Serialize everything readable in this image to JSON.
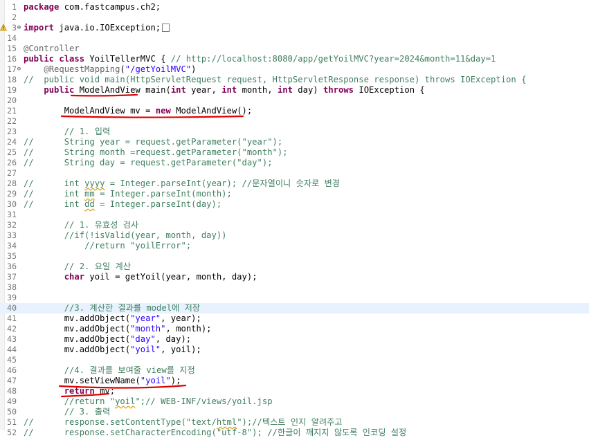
{
  "editor": {
    "lines": [
      {
        "n": "1",
        "seg": [
          {
            "t": "package ",
            "k": "kw"
          },
          {
            "t": "com.fastcampus.ch2;"
          }
        ]
      },
      {
        "n": "2",
        "seg": []
      },
      {
        "n": "3",
        "marker": "⊕",
        "warn": true,
        "seg": [
          {
            "t": "import ",
            "k": "kw"
          },
          {
            "t": "java.io.IOException;"
          },
          {
            "t": "",
            "k": "fold"
          }
        ]
      },
      {
        "n": "14",
        "seg": []
      },
      {
        "n": "15",
        "seg": [
          {
            "t": "@Controller",
            "k": "ann"
          }
        ]
      },
      {
        "n": "16",
        "seg": [
          {
            "t": "public class ",
            "k": "kw"
          },
          {
            "t": "YoilTellerMVC { "
          },
          {
            "t": "// http://localhost:8080/app/getYoilMVC?year=2024&month=11&day=1",
            "k": "cm"
          }
        ]
      },
      {
        "n": "17",
        "marker": "⊖",
        "seg": [
          {
            "t": "    "
          },
          {
            "t": "@RequestMapping",
            "k": "ann"
          },
          {
            "t": "("
          },
          {
            "t": "\"/getYoilMVC\"",
            "k": "str"
          },
          {
            "t": ")"
          }
        ]
      },
      {
        "n": "18",
        "seg": [
          {
            "t": "//  public void main(HttpServletRequest request, HttpServletResponse response) throws IOException {",
            "k": "cm"
          }
        ]
      },
      {
        "n": "19",
        "seg": [
          {
            "t": "    "
          },
          {
            "t": "public ",
            "k": "kw"
          },
          {
            "t": "ModelAndView main("
          },
          {
            "t": "int ",
            "k": "kw"
          },
          {
            "t": "year, "
          },
          {
            "t": "int ",
            "k": "kw"
          },
          {
            "t": "month, "
          },
          {
            "t": "int ",
            "k": "kw"
          },
          {
            "t": "day) "
          },
          {
            "t": "throws ",
            "k": "kw"
          },
          {
            "t": "IOException {"
          }
        ]
      },
      {
        "n": "20",
        "seg": []
      },
      {
        "n": "21",
        "seg": [
          {
            "t": "        ModelAndView mv = "
          },
          {
            "t": "new ",
            "k": "kw"
          },
          {
            "t": "ModelAndView();"
          }
        ]
      },
      {
        "n": "22",
        "seg": []
      },
      {
        "n": "23",
        "seg": [
          {
            "t": "        "
          },
          {
            "t": "// 1. 입력",
            "k": "cm"
          }
        ]
      },
      {
        "n": "24",
        "seg": [
          {
            "t": "//      String year = request.getParameter(\"year\");",
            "k": "cm"
          }
        ]
      },
      {
        "n": "25",
        "seg": [
          {
            "t": "//      String month =request.getParameter(\"month\");",
            "k": "cm"
          }
        ]
      },
      {
        "n": "26",
        "seg": [
          {
            "t": "//      String day = request.getParameter(\"day\");",
            "k": "cm"
          }
        ]
      },
      {
        "n": "27",
        "seg": []
      },
      {
        "n": "28",
        "seg": [
          {
            "t": "//      int ",
            "k": "cm"
          },
          {
            "t": "yyyy",
            "k": "cm sq"
          },
          {
            "t": " = Integer.parseInt(year); //문자열이니 숫자로 변경",
            "k": "cm"
          }
        ]
      },
      {
        "n": "29",
        "seg": [
          {
            "t": "//      int ",
            "k": "cm"
          },
          {
            "t": "mm",
            "k": "cm sq"
          },
          {
            "t": " = Integer.parseInt(month);",
            "k": "cm"
          }
        ]
      },
      {
        "n": "30",
        "seg": [
          {
            "t": "//      int ",
            "k": "cm"
          },
          {
            "t": "dd",
            "k": "cm sq"
          },
          {
            "t": " = Integer.parseInt(day);",
            "k": "cm"
          }
        ]
      },
      {
        "n": "31",
        "seg": []
      },
      {
        "n": "32",
        "seg": [
          {
            "t": "        "
          },
          {
            "t": "// 1. 유효성 검사",
            "k": "cm"
          }
        ]
      },
      {
        "n": "33",
        "seg": [
          {
            "t": "        "
          },
          {
            "t": "//if(!isValid(year, month, day))",
            "k": "cm"
          }
        ]
      },
      {
        "n": "34",
        "seg": [
          {
            "t": "            "
          },
          {
            "t": "//return \"yoilError\";",
            "k": "cm"
          }
        ]
      },
      {
        "n": "35",
        "seg": []
      },
      {
        "n": "36",
        "seg": [
          {
            "t": "        "
          },
          {
            "t": "// 2. 요일 계산",
            "k": "cm"
          }
        ]
      },
      {
        "n": "37",
        "seg": [
          {
            "t": "        "
          },
          {
            "t": "char ",
            "k": "kw"
          },
          {
            "t": "yoil = getYoil(year, month, day);"
          }
        ]
      },
      {
        "n": "38",
        "seg": []
      },
      {
        "n": "39",
        "seg": []
      },
      {
        "n": "40",
        "current": true,
        "seg": [
          {
            "t": "        "
          },
          {
            "t": "//3. 계산한 결과를 model에 저장",
            "k": "cm"
          }
        ]
      },
      {
        "n": "41",
        "seg": [
          {
            "t": "        mv.addObject("
          },
          {
            "t": "\"year\"",
            "k": "str"
          },
          {
            "t": ", year);"
          }
        ]
      },
      {
        "n": "42",
        "seg": [
          {
            "t": "        mv.addObject("
          },
          {
            "t": "\"month\"",
            "k": "str"
          },
          {
            "t": ", month);"
          }
        ]
      },
      {
        "n": "43",
        "seg": [
          {
            "t": "        mv.addObject("
          },
          {
            "t": "\"day\"",
            "k": "str"
          },
          {
            "t": ", day);"
          }
        ]
      },
      {
        "n": "44",
        "seg": [
          {
            "t": "        mv.addObject("
          },
          {
            "t": "\"yoil\"",
            "k": "str"
          },
          {
            "t": ", yoil);"
          }
        ]
      },
      {
        "n": "45",
        "seg": []
      },
      {
        "n": "46",
        "seg": [
          {
            "t": "        "
          },
          {
            "t": "//4. 결과를 보여줄 view를 지정",
            "k": "cm"
          }
        ]
      },
      {
        "n": "47",
        "seg": [
          {
            "t": "        mv.setViewName("
          },
          {
            "t": "\"yoil\"",
            "k": "str"
          },
          {
            "t": ");"
          }
        ]
      },
      {
        "n": "48",
        "seg": [
          {
            "t": "        "
          },
          {
            "t": "return ",
            "k": "kw"
          },
          {
            "t": "mv;"
          }
        ]
      },
      {
        "n": "49",
        "seg": [
          {
            "t": "        "
          },
          {
            "t": "//return \"",
            "k": "cm"
          },
          {
            "t": "yoil",
            "k": "cm sq"
          },
          {
            "t": "\";// WEB-INF/views/yoil.jsp",
            "k": "cm"
          }
        ]
      },
      {
        "n": "50",
        "seg": [
          {
            "t": "        "
          },
          {
            "t": "// 3. 출력",
            "k": "cm"
          }
        ]
      },
      {
        "n": "51",
        "seg": [
          {
            "t": "//      response.setContentType(\"text/",
            "k": "cm"
          },
          {
            "t": "html",
            "k": "cm sq"
          },
          {
            "t": "\");//텍스트 인지 알려주고",
            "k": "cm"
          }
        ]
      },
      {
        "n": "52",
        "seg": [
          {
            "t": "//      response.setCharacterEncoding(\"utf-8\"); //한글이 깨지지 않도록 인코딩 설정",
            "k": "cm"
          }
        ]
      }
    ],
    "annotation_color": "#e00000"
  }
}
